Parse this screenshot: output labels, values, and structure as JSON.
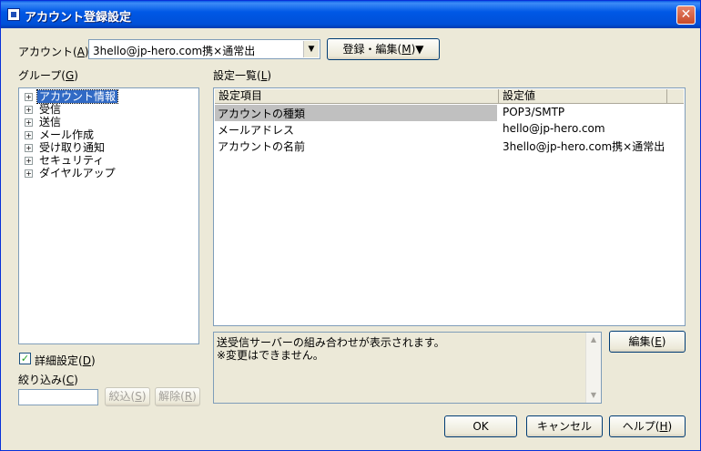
{
  "window": {
    "title": "アカウント登録設定",
    "close_glyph": "✕"
  },
  "account": {
    "label": "アカウント(",
    "hotkey": "A",
    "label_end": ")",
    "value": "3hello@jp-hero.com携×通常出",
    "dropdown_glyph": "▼"
  },
  "register_button": {
    "label": "登録・編集(",
    "hotkey": "M",
    "label_end": ")▼"
  },
  "group": {
    "label": "グループ(",
    "hotkey": "G",
    "label_end": ")",
    "items": [
      {
        "expander": "+",
        "label": "アカウント情報"
      },
      {
        "expander": "+",
        "label": "受信"
      },
      {
        "expander": "+",
        "label": "送信"
      },
      {
        "expander": "+",
        "label": "メール作成"
      },
      {
        "expander": "+",
        "label": "受け取り通知"
      },
      {
        "expander": "+",
        "label": "セキュリティ"
      },
      {
        "expander": "+",
        "label": "ダイヤルアップ"
      }
    ]
  },
  "settings_list": {
    "label": "設定一覧(",
    "hotkey": "L",
    "label_end": ")",
    "columns": [
      "設定項目",
      "設定値"
    ],
    "rows": [
      {
        "item": "アカウントの種類",
        "value": "POP3/SMTP"
      },
      {
        "item": "メールアドレス",
        "value": "hello@jp-hero.com"
      },
      {
        "item": "アカウントの名前",
        "value": "3hello@jp-hero.com携×通常出"
      }
    ]
  },
  "description": {
    "line1": "送受信サーバーの組み合わせが表示されます。",
    "line2": "※変更はできません。",
    "scroll_up": "▲",
    "scroll_down": "▼"
  },
  "edit_button": {
    "label": "編集(",
    "hotkey": "E",
    "label_end": ")"
  },
  "detail_checkbox": {
    "check_glyph": "✓",
    "label": "詳細設定(",
    "hotkey": "D",
    "label_end": ")"
  },
  "filter": {
    "label": "絞り込み(",
    "hotkey": "C",
    "label_end": ")",
    "value": "",
    "apply_button": {
      "label": "絞込(",
      "hotkey": "S",
      "label_end": ")"
    },
    "clear_button": {
      "label": "解除(",
      "hotkey": "R",
      "label_end": ")"
    }
  },
  "footer": {
    "ok": "OK",
    "cancel": "キャンセル",
    "help": {
      "label": "ヘルプ(",
      "hotkey": "H",
      "label_end": ")"
    }
  }
}
